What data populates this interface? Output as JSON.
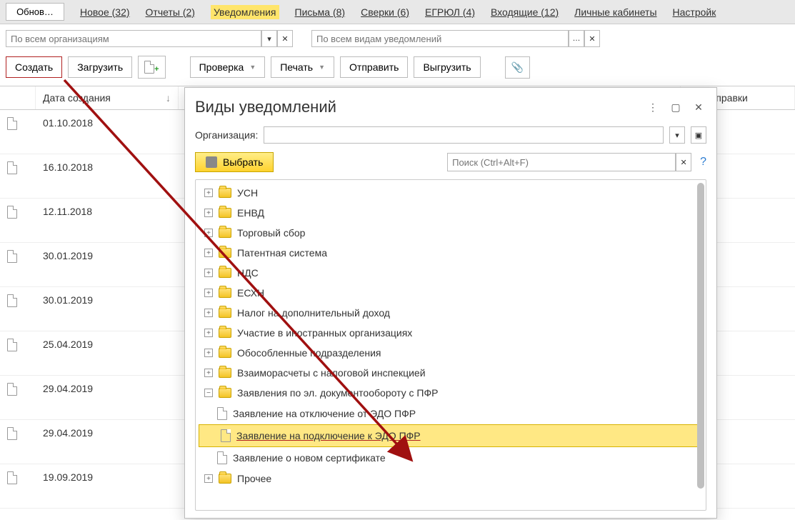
{
  "topbar": {
    "refresh": "Обнов…",
    "links": [
      {
        "label": "Новое (32)"
      },
      {
        "label": "Отчеты (2)"
      },
      {
        "label": "Уведомления",
        "active": true
      },
      {
        "label": "Письма (8)"
      },
      {
        "label": "Сверки (6)"
      },
      {
        "label": "ЕГРЮЛ (4)"
      },
      {
        "label": "Входящие (12)"
      },
      {
        "label": "Личные кабинеты"
      },
      {
        "label": "Настройк"
      }
    ]
  },
  "filters": {
    "org_placeholder": "По всем организациям",
    "type_placeholder": "По всем видам уведомлений"
  },
  "toolbar": {
    "create": "Создать",
    "load": "Загрузить",
    "check": "Проверка",
    "print": "Печать",
    "send": "Отправить",
    "export": "Выгрузить"
  },
  "table": {
    "header_date": "Дата создания",
    "header_sent": "ата отправки",
    "rows": [
      {
        "date": "01.10.2018"
      },
      {
        "date": "16.10.2018"
      },
      {
        "date": "12.11.2018"
      },
      {
        "date": "30.01.2019"
      },
      {
        "date": "30.01.2019"
      },
      {
        "date": "25.04.2019"
      },
      {
        "date": "29.04.2019"
      },
      {
        "date": "29.04.2019"
      },
      {
        "date": "19.09.2019"
      }
    ]
  },
  "dialog": {
    "title": "Виды уведомлений",
    "org_label": "Организация:",
    "choose": "Выбрать",
    "search_placeholder": "Поиск (Ctrl+Alt+F)",
    "tree": [
      {
        "label": "УСН"
      },
      {
        "label": "ЕНВД"
      },
      {
        "label": "Торговый сбор"
      },
      {
        "label": "Патентная система"
      },
      {
        "label": "НДС"
      },
      {
        "label": "ЕСХН"
      },
      {
        "label": "Налог на дополнительный доход"
      },
      {
        "label": "Участие в иностранных организациях"
      },
      {
        "label": "Обособленные подразделения"
      },
      {
        "label": "Взаиморасчеты с налоговой инспекцией"
      },
      {
        "label": "Заявления по эл. документообороту с ПФР",
        "expanded": true,
        "children": [
          {
            "label": "Заявление на отключение от ЭДО ПФР"
          },
          {
            "label": "Заявление на подключение к ЭДО ПФР",
            "highlight": true
          },
          {
            "label": "Заявление о новом сертификате"
          }
        ]
      },
      {
        "label": "Прочее"
      }
    ]
  }
}
